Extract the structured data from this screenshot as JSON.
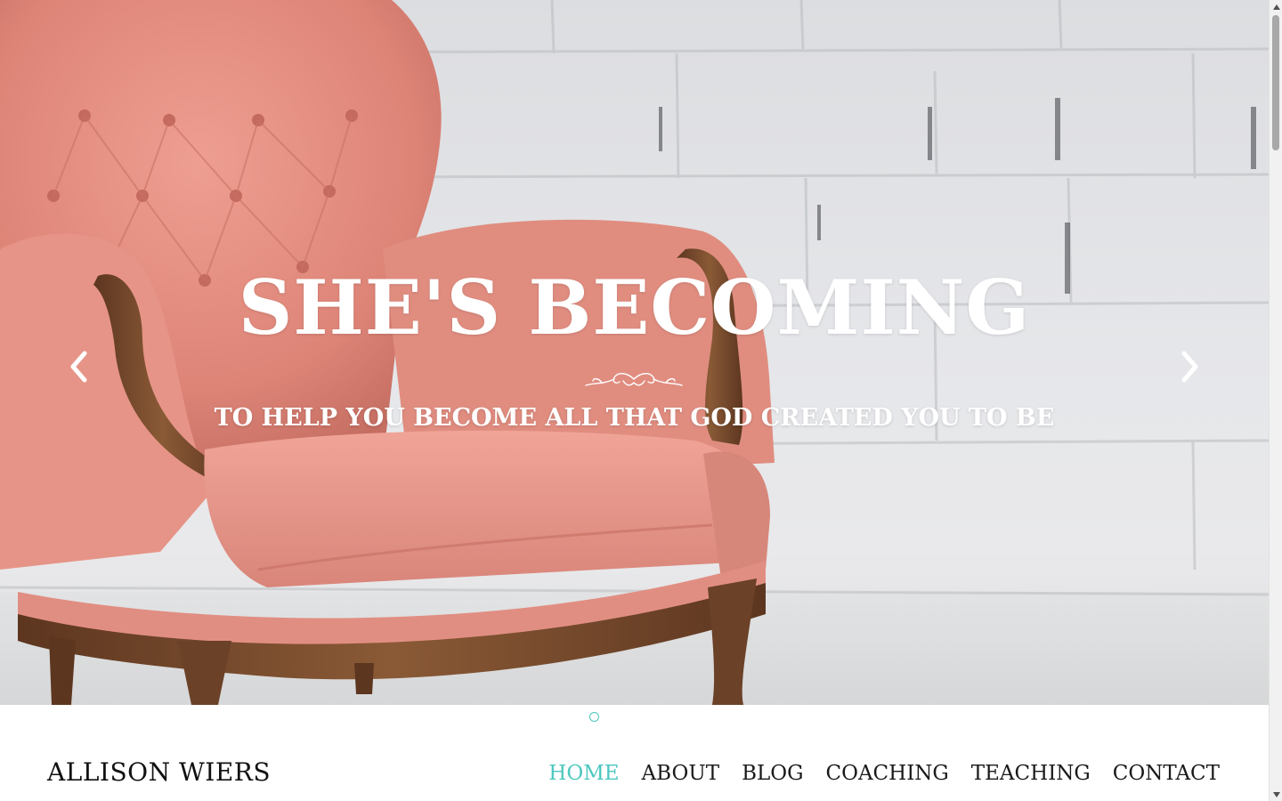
{
  "hero": {
    "title": "SHE'S BECOMING",
    "subtitle": "TO HELP YOU BECOME ALL THAT GOD CREATED YOU TO BE",
    "image": "pink-velvet-armchair-against-white-brick-wall",
    "prev_icon": "chevron-left-icon",
    "next_icon": "chevron-right-icon",
    "ornament_icon": "flourish-divider-icon"
  },
  "carousel": {
    "slide_count": 1,
    "active_index": 0
  },
  "header": {
    "logo": "ALLISON WIERS",
    "nav": [
      {
        "label": "HOME",
        "active": true
      },
      {
        "label": "ABOUT",
        "active": false
      },
      {
        "label": "BLOG",
        "active": false
      },
      {
        "label": "COACHING",
        "active": false
      },
      {
        "label": "TEACHING",
        "active": false
      },
      {
        "label": "CONTACT",
        "active": false
      }
    ]
  },
  "colors": {
    "accent": "#4cc7bf",
    "text": "#1a1a1a",
    "hero_text": "#ffffff",
    "chair_pink": "#e38f83",
    "wood": "#7a4a2c"
  }
}
